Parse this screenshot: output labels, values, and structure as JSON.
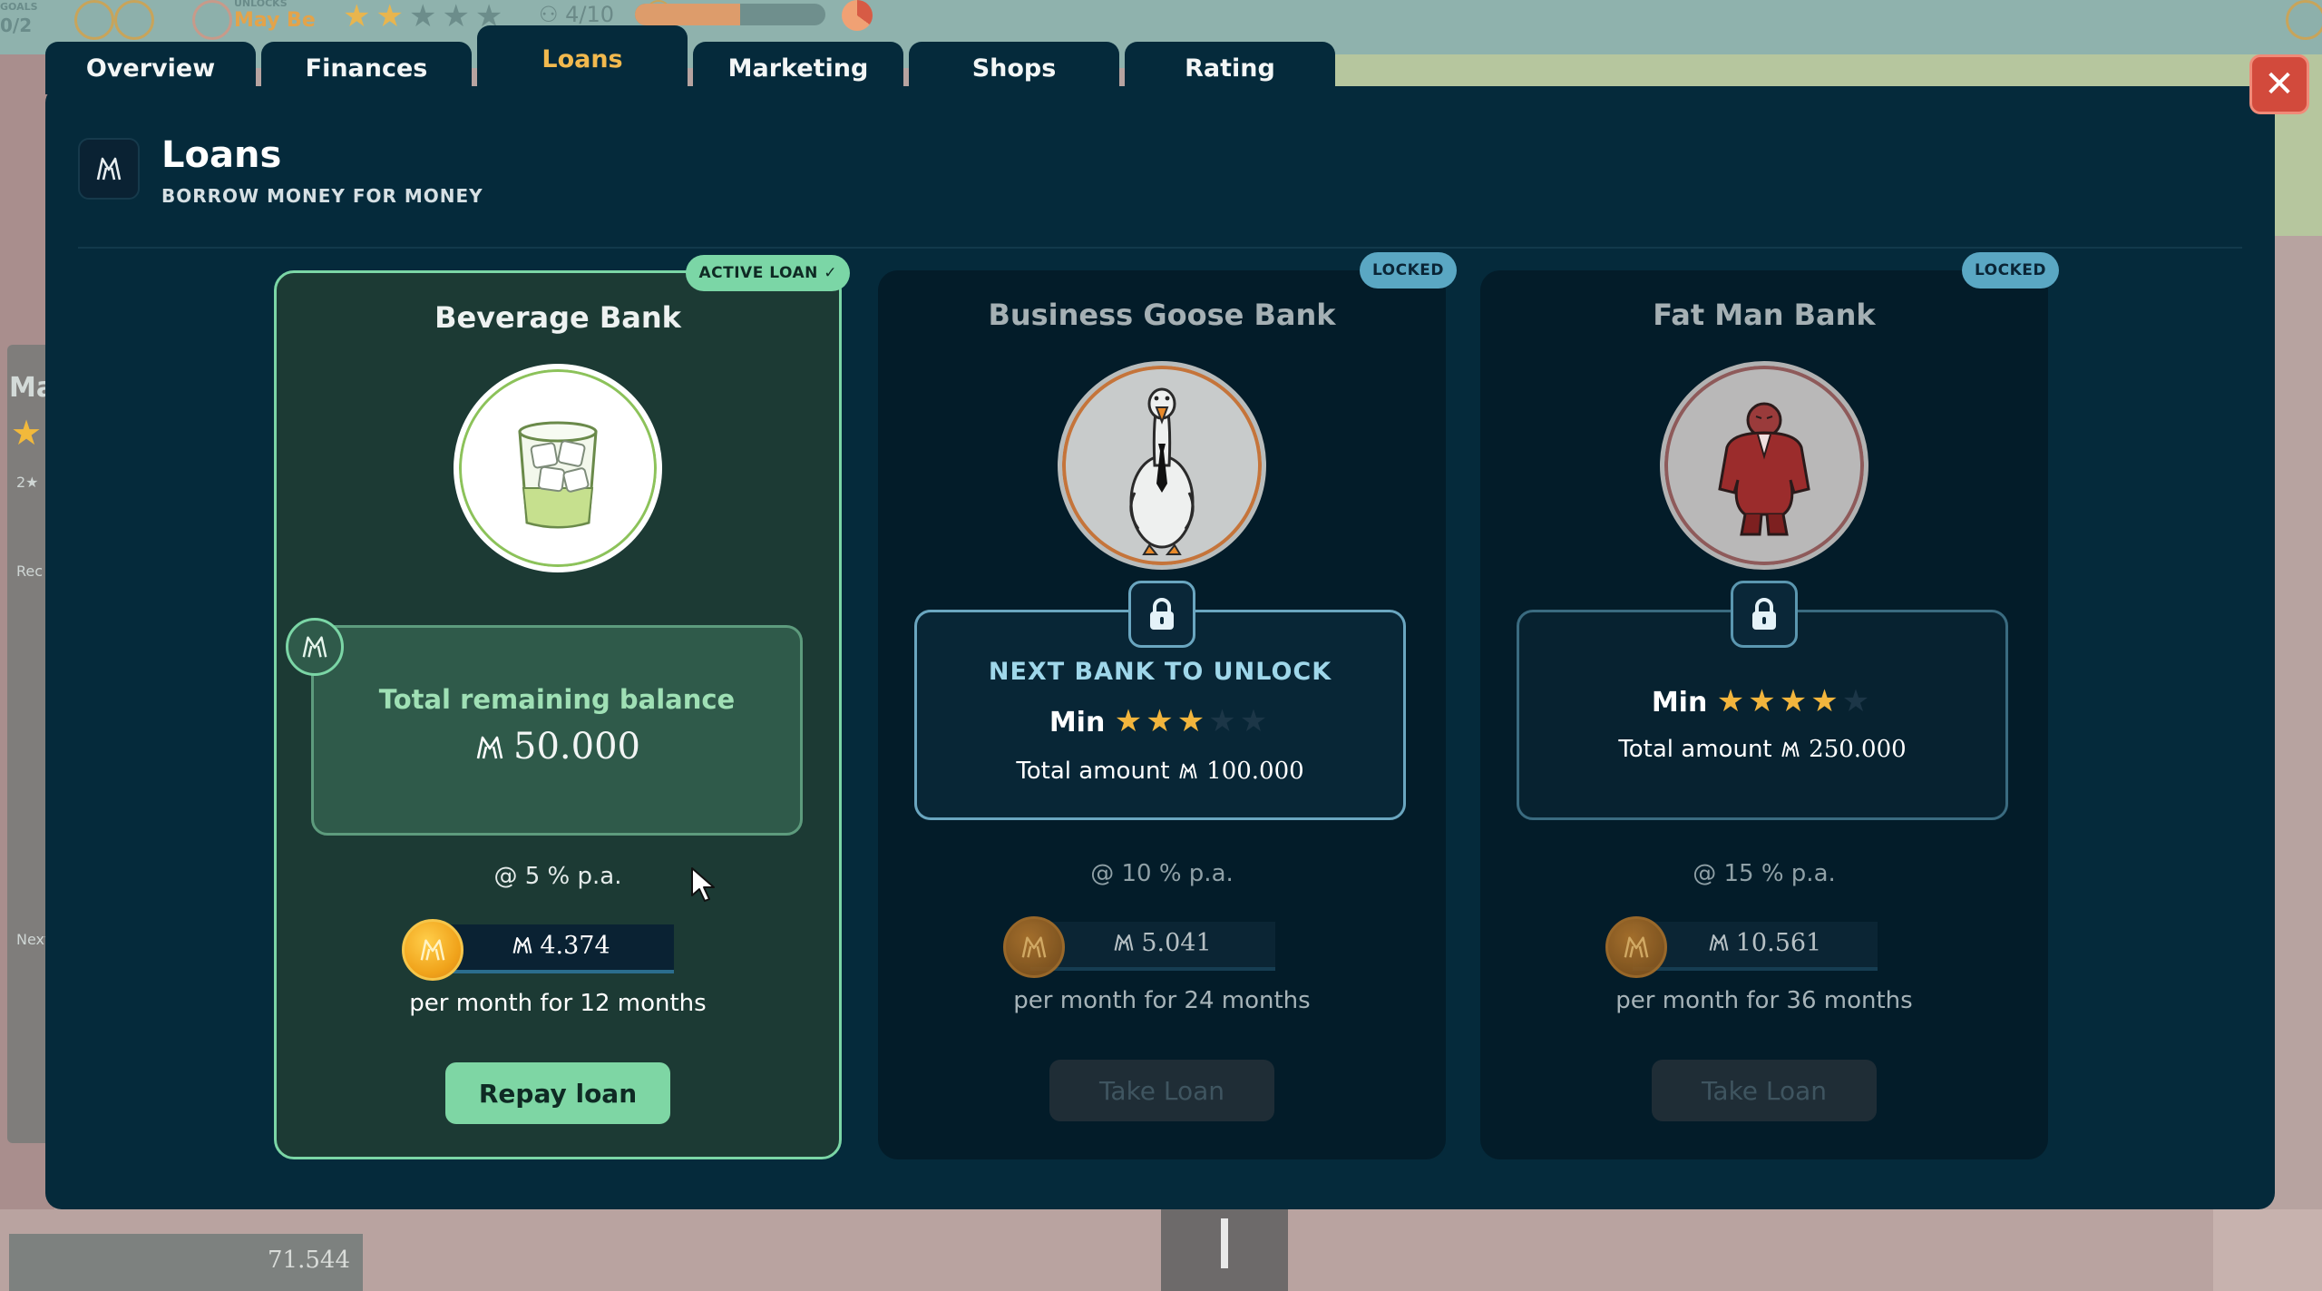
{
  "hud": {
    "goals_label": "GOALS",
    "goals_value": "0/2",
    "unlocks_label": "UNLOCKS",
    "unlock_name": "May Be",
    "stars_filled": 2,
    "stars_total": 5,
    "people": "4/10",
    "progress": 0.55
  },
  "background": {
    "side_title": "Ma",
    "side_stars": "2★",
    "side_label_1": "Rec",
    "side_label_2": "Next",
    "money": "71.544"
  },
  "tabs": [
    {
      "label": "Overview"
    },
    {
      "label": "Finances"
    },
    {
      "label": "Loans"
    },
    {
      "label": "Marketing"
    },
    {
      "label": "Shops"
    },
    {
      "label": "Rating"
    }
  ],
  "active_tab": "Loans",
  "close_icon": "close-icon",
  "header": {
    "title": "Loans",
    "subtitle": "BORROW MONEY FOR MONEY",
    "icon": "money-icon"
  },
  "banks": [
    {
      "name": "Beverage Bank",
      "badge": "ACTIVE LOAN ✓",
      "portrait_icon": "whiskey-glass-icon",
      "balance_label": "Total remaining balance",
      "balance": "50.000",
      "rate": "@ 5 % p.a.",
      "payment": "4.374",
      "per_month": "per month for 12 months",
      "button": "Repay loan"
    },
    {
      "name": "Business Goose Bank",
      "badge": "LOCKED",
      "portrait_icon": "goose-icon",
      "next_label": "NEXT BANK TO UNLOCK",
      "min_label": "Min",
      "min_stars": 3,
      "total_label": "Total amount",
      "total": "100.000",
      "rate": "@ 10 % p.a.",
      "payment": "5.041",
      "per_month": "per month for 24 months",
      "button": "Take Loan"
    },
    {
      "name": "Fat Man Bank",
      "badge": "LOCKED",
      "portrait_icon": "fat-man-icon",
      "min_label": "Min",
      "min_stars": 4,
      "total_label": "Total amount",
      "total": "250.000",
      "rate": "@ 15 % p.a.",
      "payment": "10.561",
      "per_month": "per month for 36 months",
      "button": "Take Loan"
    }
  ],
  "colors": {
    "modal_bg": "#052a3b",
    "active_tab_text": "#f2b94e",
    "accent_green": "#7bd6a6",
    "locked_badge": "#5aa7c3",
    "star": "#f2b53d",
    "close_button": "#d24a3c"
  }
}
